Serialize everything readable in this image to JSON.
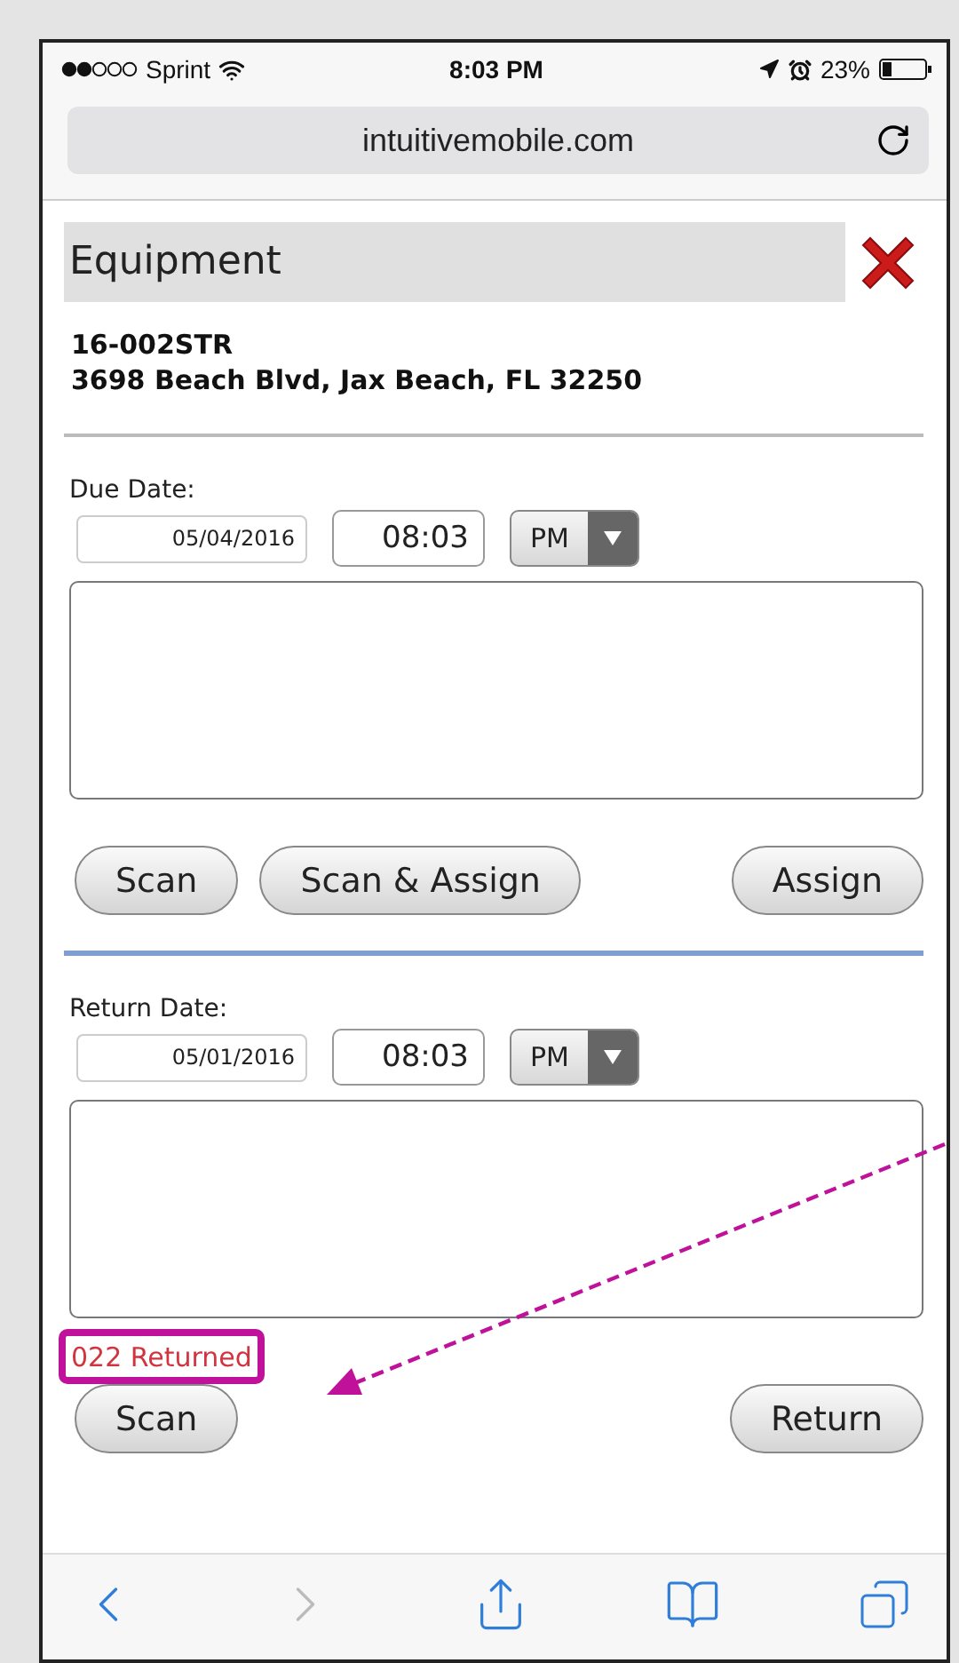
{
  "status_bar": {
    "carrier": "Sprint",
    "time": "8:03 PM",
    "battery": "23%"
  },
  "browser": {
    "url": "intuitivemobile.com"
  },
  "page": {
    "title": "Equipment",
    "job_id": "16-002STR",
    "address": "3698 Beach Blvd, Jax Beach, FL 32250"
  },
  "sections": [
    {
      "label": "Due Date:",
      "date": "05/04/2016",
      "time": "08:03",
      "meridiem": "PM",
      "left_buttons": [
        "Scan",
        "Scan & Assign"
      ],
      "right_buttons": [
        "Assign"
      ]
    },
    {
      "label": "Return Date:",
      "date": "05/01/2016",
      "time": "08:03",
      "meridiem": "PM",
      "status": {
        "text": "022 Returned",
        "highlighted": true
      },
      "left_buttons": [
        "Scan"
      ],
      "right_buttons": [
        "Return"
      ]
    }
  ],
  "toolbar": [
    {
      "kind": "back",
      "disabled": false
    },
    {
      "kind": "forward",
      "disabled": true
    },
    {
      "kind": "share",
      "disabled": false
    },
    {
      "kind": "bookmarks",
      "disabled": false
    },
    {
      "kind": "tabs",
      "disabled": false
    }
  ]
}
